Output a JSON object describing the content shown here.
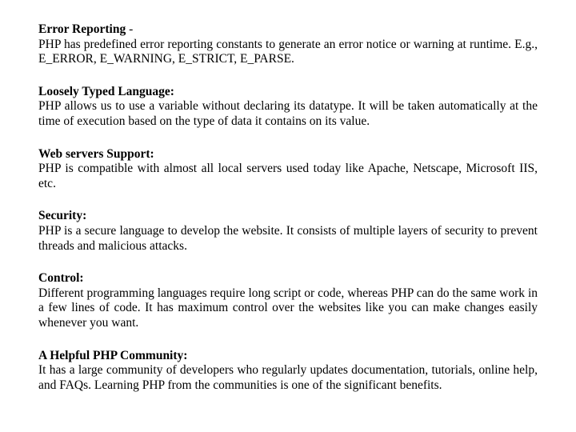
{
  "sections": [
    {
      "heading": "Error Reporting",
      "sep": " -",
      "body": "PHP has predefined error reporting constants to generate an error notice or warning at runtime. E.g., E_ERROR, E_WARNING, E_STRICT, E_PARSE."
    },
    {
      "heading": "Loosely Typed Language:",
      "sep": "",
      "body": "PHP allows us to use a variable without declaring its datatype. It will be taken automatically at the time of execution based on the type of data it contains on its value."
    },
    {
      "heading": "Web servers Support:",
      "sep": "",
      "body": "PHP is compatible with almost all local servers used today like Apache, Netscape, Microsoft IIS, etc."
    },
    {
      "heading": "Security:",
      "sep": "",
      "body": "PHP is a secure language to develop the website. It consists of multiple layers of security to prevent threads and malicious attacks."
    },
    {
      "heading": "Control:",
      "sep": "",
      "body": "Different programming languages require long script or code, whereas PHP can do the same work in a few lines of code. It has maximum control over the websites like you can make changes easily whenever you want."
    },
    {
      "heading": "A Helpful PHP Community:",
      "sep": "",
      "body": "It has a large community of developers who regularly updates documentation, tutorials, online help, and FAQs. Learning PHP from the communities is one of the significant benefits."
    }
  ]
}
